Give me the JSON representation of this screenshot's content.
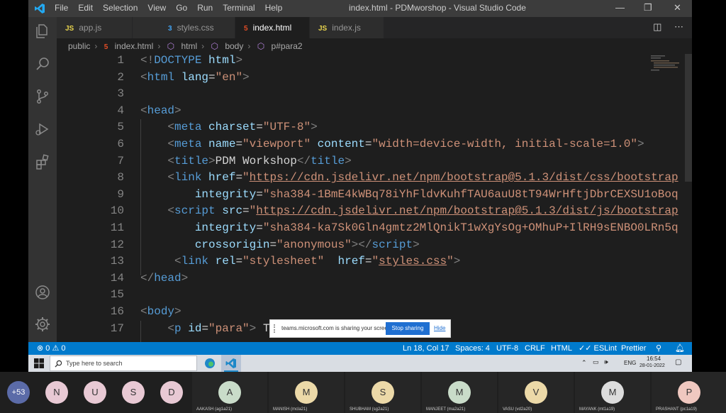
{
  "window": {
    "menu": [
      "File",
      "Edit",
      "Selection",
      "View",
      "Go",
      "Run",
      "Terminal",
      "Help"
    ],
    "title": "index.html - PDMworshop - Visual Studio Code",
    "controls": {
      "minimize": "—",
      "restore": "❐",
      "close": "✕"
    }
  },
  "tabs": [
    {
      "label": "app.js",
      "icon": "JS",
      "type": "js"
    },
    {
      "label": "styles.css",
      "icon": "3",
      "type": "css"
    },
    {
      "label": "index.html",
      "icon": "5",
      "type": "html",
      "active": true
    },
    {
      "label": "index.js",
      "icon": "JS",
      "type": "js"
    }
  ],
  "breadcrumb": [
    "public",
    "index.html",
    "html",
    "body",
    "p#para2"
  ],
  "editor": {
    "line_numbers": [
      "1",
      "2",
      "3",
      "4",
      "5",
      "6",
      "7",
      "8",
      "9",
      "10",
      "11",
      "12",
      "13",
      "14",
      "15",
      "16",
      "17"
    ],
    "lines": [
      [
        {
          "t": "<!",
          "c": "pun"
        },
        {
          "t": "DOCTYPE",
          "c": "tag"
        },
        {
          "t": " ",
          "c": "txt"
        },
        {
          "t": "html",
          "c": "attr"
        },
        {
          "t": ">",
          "c": "pun"
        }
      ],
      [
        {
          "t": "<",
          "c": "pun"
        },
        {
          "t": "html",
          "c": "tag"
        },
        {
          "t": " ",
          "c": "txt"
        },
        {
          "t": "lang",
          "c": "attr"
        },
        {
          "t": "=",
          "c": "txt"
        },
        {
          "t": "\"en\"",
          "c": "str"
        },
        {
          "t": ">",
          "c": "pun"
        }
      ],
      [],
      [
        {
          "t": "<",
          "c": "pun"
        },
        {
          "t": "head",
          "c": "tag"
        },
        {
          "t": ">",
          "c": "pun"
        }
      ],
      [
        {
          "t": "    ",
          "c": "txt"
        },
        {
          "t": "<",
          "c": "pun"
        },
        {
          "t": "meta",
          "c": "tag"
        },
        {
          "t": " ",
          "c": "txt"
        },
        {
          "t": "charset",
          "c": "attr"
        },
        {
          "t": "=",
          "c": "txt"
        },
        {
          "t": "\"UTF-8\"",
          "c": "str"
        },
        {
          "t": ">",
          "c": "pun"
        }
      ],
      [
        {
          "t": "    ",
          "c": "txt"
        },
        {
          "t": "<",
          "c": "pun"
        },
        {
          "t": "meta",
          "c": "tag"
        },
        {
          "t": " ",
          "c": "txt"
        },
        {
          "t": "name",
          "c": "attr"
        },
        {
          "t": "=",
          "c": "txt"
        },
        {
          "t": "\"viewport\"",
          "c": "str"
        },
        {
          "t": " ",
          "c": "txt"
        },
        {
          "t": "content",
          "c": "attr"
        },
        {
          "t": "=",
          "c": "txt"
        },
        {
          "t": "\"width=device-width, initial-scale=1.0\"",
          "c": "str"
        },
        {
          "t": ">",
          "c": "pun"
        }
      ],
      [
        {
          "t": "    ",
          "c": "txt"
        },
        {
          "t": "<",
          "c": "pun"
        },
        {
          "t": "title",
          "c": "tag"
        },
        {
          "t": ">",
          "c": "pun"
        },
        {
          "t": "PDM Workshop",
          "c": "txt"
        },
        {
          "t": "</",
          "c": "pun"
        },
        {
          "t": "title",
          "c": "tag"
        },
        {
          "t": ">",
          "c": "pun"
        }
      ],
      [
        {
          "t": "    ",
          "c": "txt"
        },
        {
          "t": "<",
          "c": "pun"
        },
        {
          "t": "link",
          "c": "tag"
        },
        {
          "t": " ",
          "c": "txt"
        },
        {
          "t": "href",
          "c": "attr"
        },
        {
          "t": "=",
          "c": "txt"
        },
        {
          "t": "\"",
          "c": "str"
        },
        {
          "t": "https://cdn.jsdelivr.net/npm/bootstrap@5.1.3/dist/css/bootstrap",
          "c": "link"
        }
      ],
      [
        {
          "t": "        ",
          "c": "txt"
        },
        {
          "t": "integrity",
          "c": "attr"
        },
        {
          "t": "=",
          "c": "txt"
        },
        {
          "t": "\"sha384-1BmE4kWBq78iYhFldvKuhfTAU6auU8tT94WrHftjDbrCEXSU1oBoq",
          "c": "str"
        }
      ],
      [
        {
          "t": "    ",
          "c": "txt"
        },
        {
          "t": "<",
          "c": "pun"
        },
        {
          "t": "script",
          "c": "tag"
        },
        {
          "t": " ",
          "c": "txt"
        },
        {
          "t": "src",
          "c": "attr"
        },
        {
          "t": "=",
          "c": "txt"
        },
        {
          "t": "\"",
          "c": "str"
        },
        {
          "t": "https://cdn.jsdelivr.net/npm/bootstrap@5.1.3/dist/js/bootstrap",
          "c": "link"
        }
      ],
      [
        {
          "t": "        ",
          "c": "txt"
        },
        {
          "t": "integrity",
          "c": "attr"
        },
        {
          "t": "=",
          "c": "txt"
        },
        {
          "t": "\"sha384-ka7Sk0Gln4gmtz2MlQnikT1wXgYsOg+OMhuP+IlRH9sENBO0LRn5q",
          "c": "str"
        }
      ],
      [
        {
          "t": "        ",
          "c": "txt"
        },
        {
          "t": "crossorigin",
          "c": "attr"
        },
        {
          "t": "=",
          "c": "txt"
        },
        {
          "t": "\"anonymous\"",
          "c": "str"
        },
        {
          "t": "></",
          "c": "pun"
        },
        {
          "t": "script",
          "c": "tag"
        },
        {
          "t": ">",
          "c": "pun"
        }
      ],
      [
        {
          "t": "     ",
          "c": "txt"
        },
        {
          "t": "<",
          "c": "pun"
        },
        {
          "t": "link",
          "c": "tag"
        },
        {
          "t": " ",
          "c": "txt"
        },
        {
          "t": "rel",
          "c": "attr"
        },
        {
          "t": "=",
          "c": "txt"
        },
        {
          "t": "\"stylesheet\"",
          "c": "str"
        },
        {
          "t": "  ",
          "c": "txt"
        },
        {
          "t": "href",
          "c": "attr"
        },
        {
          "t": "=",
          "c": "txt"
        },
        {
          "t": "\"",
          "c": "str"
        },
        {
          "t": "styles.css",
          "c": "link"
        },
        {
          "t": "\"",
          "c": "str"
        },
        {
          "t": ">",
          "c": "pun"
        }
      ],
      [
        {
          "t": "</",
          "c": "pun"
        },
        {
          "t": "head",
          "c": "tag"
        },
        {
          "t": ">",
          "c": "pun"
        }
      ],
      [],
      [
        {
          "t": "<",
          "c": "pun"
        },
        {
          "t": "body",
          "c": "tag"
        },
        {
          "t": ">",
          "c": "pun"
        }
      ],
      [
        {
          "t": "    ",
          "c": "txt"
        },
        {
          "t": "<",
          "c": "pun"
        },
        {
          "t": "p",
          "c": "tag"
        },
        {
          "t": " ",
          "c": "txt"
        },
        {
          "t": "id",
          "c": "attr"
        },
        {
          "t": "=",
          "c": "txt"
        },
        {
          "t": "\"para\"",
          "c": "str"
        },
        {
          "t": ">",
          "c": "pun"
        },
        {
          "t": " This",
          "c": "txt"
        }
      ]
    ]
  },
  "status": {
    "errors": "⊗ 0 ⚠ 0",
    "position": "Ln 18, Col 17",
    "spaces": "Spaces: 4",
    "encoding": "UTF-8",
    "eol": "CRLF",
    "language": "HTML",
    "eslint": "✓✓ ESLint",
    "prettier": "Prettier"
  },
  "share_popup": {
    "message": "teams.microsoft.com is sharing your screen.",
    "stop": "Stop sharing",
    "hide": "Hide"
  },
  "taskbar": {
    "search_placeholder": "Type here to search",
    "lang": "ENG",
    "time": "16:54",
    "date": "28-01-2022"
  },
  "teams": {
    "overflow": "+53",
    "small_participants": [
      {
        "initial": "N",
        "color": "#e8c9d4"
      },
      {
        "initial": "U",
        "color": "#e8c9d4"
      },
      {
        "initial": "S",
        "color": "#e8c9d4"
      },
      {
        "initial": "D",
        "color": "#e8c9d4"
      }
    ],
    "participants": [
      {
        "initial": "A",
        "name": "AAKASH (ag1a21)",
        "color": "#c9dcc9"
      },
      {
        "initial": "M",
        "name": "MANISH (mcla21)",
        "color": "#ecd9a8"
      },
      {
        "initial": "S",
        "name": "SHUBHAM (sg2a21)",
        "color": "#ecd9a8"
      },
      {
        "initial": "M",
        "name": "MANJEET (ma2a21)",
        "color": "#c9dcc9"
      },
      {
        "initial": "V",
        "name": "VASU (vd2a20)",
        "color": "#ecd9a8"
      },
      {
        "initial": "M",
        "name": "MAYANK (mt1a19)",
        "color": "#dcdcdc"
      },
      {
        "initial": "P",
        "name": "PRASHANT (pc1a19)",
        "color": "#f0c8c0"
      }
    ]
  }
}
